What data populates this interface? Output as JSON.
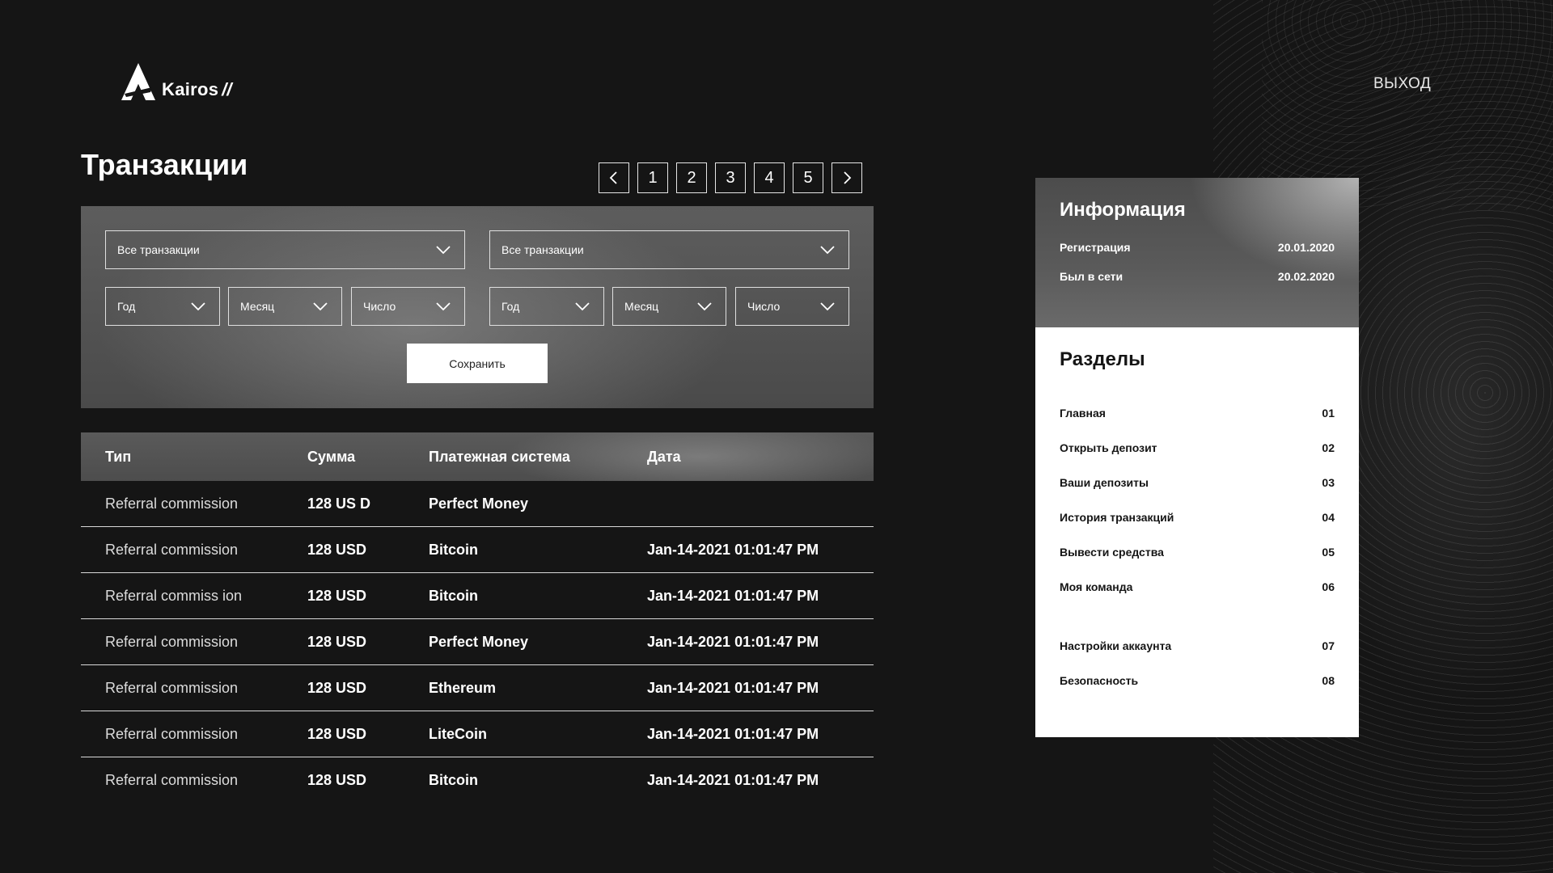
{
  "brand": {
    "name": "Kairos",
    "slash": "//"
  },
  "header": {
    "logout_label": "ВЫХОД"
  },
  "page": {
    "title": "Транзакции"
  },
  "pagination": {
    "pages": [
      "1",
      "2",
      "3",
      "4",
      "5"
    ],
    "prev_icon": "chevron-left-icon",
    "next_icon": "chevron-right-icon"
  },
  "filters": {
    "left": {
      "type_value": "Все транзакции",
      "year": "Год",
      "month": "Месяц",
      "day": "Число"
    },
    "right": {
      "type_value": "Все транзакции",
      "year": "Год",
      "month": "Месяц",
      "day": "Число"
    },
    "save_label": "Сохранить"
  },
  "table": {
    "headers": [
      "Тип",
      "Сумма",
      "Платежная система",
      "Дата"
    ],
    "rows": [
      [
        "Referral commission",
        "128 US D",
        "Perfect Money",
        ""
      ],
      [
        "Referral commission",
        "128 USD",
        "Bitcoin",
        "Jan-14-2021 01:01:47 PM"
      ],
      [
        "Referral commiss ion",
        "128 USD",
        "Bitcoin",
        "Jan-14-2021 01:01:47 PM"
      ],
      [
        "Referral commission",
        "128 USD",
        "Perfect Money",
        "Jan-14-2021 01:01:47 PM"
      ],
      [
        "Referral commission",
        "128 USD",
        "Ethereum",
        "Jan-14-2021 01:01:47 PM"
      ],
      [
        "Referral commission",
        "128 USD",
        "LiteCoin",
        "Jan-14-2021 01:01:47 PM"
      ],
      [
        "Referral commission",
        "128 USD",
        "Bitcoin",
        "Jan-14-2021 01:01:47 PM"
      ]
    ]
  },
  "info": {
    "title": "Информация",
    "registration_label": "Регистрация",
    "registration_value": "20.01.2020",
    "last_seen_label": "Был в сети",
    "last_seen_value": "20.02.2020"
  },
  "sections": {
    "title": "Разделы",
    "items": [
      {
        "label": "Главная",
        "num": "01"
      },
      {
        "label": "Открыть депозит",
        "num": "02"
      },
      {
        "label": "Ваши депозиты",
        "num": "03"
      },
      {
        "label": "История транзакций",
        "num": "04"
      },
      {
        "label": "Вывести средства",
        "num": "05"
      },
      {
        "label": "Моя команда",
        "num": "06"
      },
      {
        "label": "Настройки аккаунта",
        "num": "07"
      },
      {
        "label": "Безопасность",
        "num": "08"
      }
    ]
  }
}
